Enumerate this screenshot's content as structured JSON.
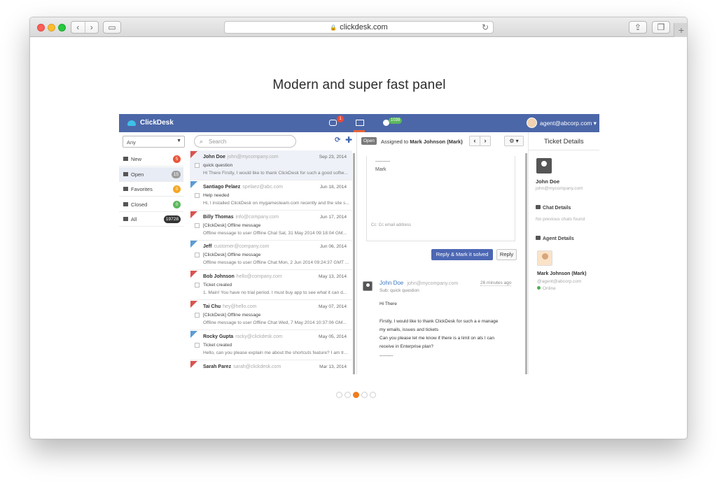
{
  "browser": {
    "url": "clickdesk.com"
  },
  "page": {
    "headline": "Modern and super fast panel"
  },
  "app": {
    "brand": "ClickDesk",
    "chat_badge": "1",
    "visitors_badge": "1039",
    "agent_email": "agent@abcorp.com",
    "colors": {
      "topbar": "#4c67a8",
      "accent_orange": "#e8633a",
      "primary_button": "#4c67b3"
    }
  },
  "filters": {
    "select_value": "Any",
    "items": [
      {
        "label": "New",
        "count": "5",
        "color": "#e8553a"
      },
      {
        "label": "Open",
        "count": "15",
        "color": "#9e9e9e"
      },
      {
        "label": "Favorites",
        "count": "0",
        "color": "#f5a623"
      },
      {
        "label": "Closed",
        "count": "0",
        "color": "#5cb85c"
      },
      {
        "label": "All",
        "count": "19728",
        "color": "#333333"
      }
    ]
  },
  "list": {
    "search_placeholder": "Search",
    "rows": [
      {
        "name": "John Doe",
        "email": "john@mycompany.com",
        "date": "Sep 23, 2014",
        "subject": "quick question",
        "preview": "Hi There Firstly, I would like to thank ClickDesk for such a good softw...",
        "flag": "#d9534f"
      },
      {
        "name": "Santiago Pelaez",
        "email": "spelaez@abc.com",
        "date": "Jun 18, 2014",
        "subject": "Help needed",
        "preview": "Hi, I installed ClickDesk on mygamesteam.com recently and the site s...",
        "flag": "#5b9bd5"
      },
      {
        "name": "Billy Thomas",
        "email": "info@company.com",
        "date": "Jun 17, 2014",
        "subject": "[ClickDesk] Offline message",
        "preview": "Offline message to user Offline Chat Sat, 31 May 2014 09:18:04 GM...",
        "flag": "#d9534f"
      },
      {
        "name": "Jeff",
        "email": "customer@company.com",
        "date": "Jun 06, 2014",
        "subject": "[ClickDesk] Offline message",
        "preview": "Offline message to user Offline Chat Mon, 2 Jun 2014 09:24:37 GMT ...",
        "flag": "#5b9bd5"
      },
      {
        "name": "Bob Johnson",
        "email": "hello@company.com",
        "date": "May 13, 2014",
        "subject": "Ticket created",
        "preview": "1. Main! You have no trial period. I must buy app to see what it can d...",
        "flag": "#d9534f"
      },
      {
        "name": "Tai Chu",
        "email": "hey@hello.com",
        "date": "May 07, 2014",
        "subject": "[ClickDesk] Offline message",
        "preview": "Offline message to user Offline Chat Wed, 7 May 2014 10:37:06 GM...",
        "flag": "#d9534f"
      },
      {
        "name": "Rocky Gupta",
        "email": "rocky@clickdesk.com",
        "date": "May 05, 2014",
        "subject": "Ticket created",
        "preview": "Hello, can you please explain me about the shortcuts feature? I am tr...",
        "flag": "#5b9bd5"
      },
      {
        "name": "Sarah Parez",
        "email": "sarah@clickdesk.com",
        "date": "Mar 13, 2014",
        "subject": "",
        "preview": "",
        "flag": "#d9534f"
      }
    ]
  },
  "detail": {
    "status_tag": "Open",
    "assigned_prefix": "Assigned to",
    "assigned_name": "Mark Johnson (Mark)",
    "compose_dash": "---------",
    "compose_signature": "Mark",
    "cc_placeholder": "Cc: Cc email address",
    "reply_solve_label": "Reply & Mark it solved",
    "reply_label": "Reply",
    "message": {
      "name": "John Doe",
      "email": "john@mycompany.com",
      "time": "26 minutes ago",
      "subject": "Sub: quick question",
      "lines": [
        "Hi There",
        "Firstly, I would like to thank ClickDesk for such a e manage",
        "my emails, issues and tickets",
        "Can you please let me know if there is a limit on ats I can",
        "receive in Enterprise plan?",
        "---------"
      ]
    }
  },
  "ticket": {
    "title": "Ticket Details",
    "customer_name": "John Doe",
    "customer_email": "john@mycompany.com",
    "chat_details_label": "Chat Details",
    "no_chats": "No previous chats found",
    "agent_details_label": "Agent Details",
    "agent_name": "Mark Johnson (Mark)",
    "agent_email": "@agent@abcorp.com",
    "agent_status": "Online"
  },
  "pagination": {
    "count": 5,
    "active_index": 2
  }
}
